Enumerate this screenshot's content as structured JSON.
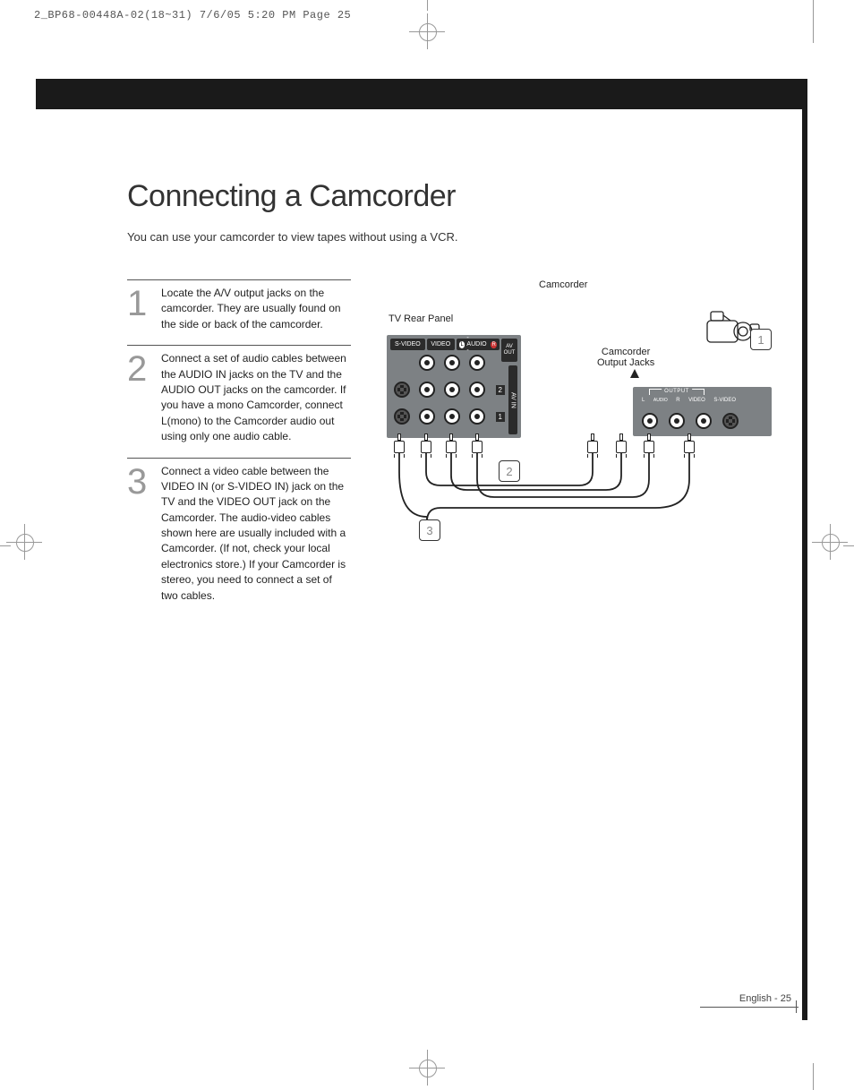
{
  "slug": "2_BP68-00448A-02(18~31)  7/6/05  5:20 PM  Page 25",
  "title": "Connecting a Camcorder",
  "intro": "You can use your camcorder to view tapes without using a VCR.",
  "steps": [
    {
      "num": "1",
      "text": "Locate the A/V output jacks on the camcorder. They are usually found on the side or back of the camcorder."
    },
    {
      "num": "2",
      "text": "Connect a set of audio cables between the AUDIO IN jacks on the TV and the AUDIO OUT jacks on the camcorder. If you have a mono Camcorder, connect L(mono) to the Camcorder audio out using only one audio cable."
    },
    {
      "num": "3",
      "text": "Connect a video cable between the VIDEO IN (or S-VIDEO IN) jack on the TV and the VIDEO OUT jack on the Camcorder. The audio-video cables shown here are usually included with a Camcorder. (If not, check your local electronics store.) If your Camcorder is stereo, you need to connect a set of two cables."
    }
  ],
  "diagram": {
    "camcorder_label": "Camcorder",
    "tv_panel_label": "TV Rear Panel",
    "output_jacks_label": "Camcorder\nOutput Jacks",
    "panel_headers": {
      "svideo": "S-VIDEO",
      "video": "VIDEO",
      "audio_l": "L",
      "audio_sep": "- AUDIO -",
      "audio_r": "R"
    },
    "av_out": "AV\nOUT",
    "av_in": "AV IN",
    "row_nums": [
      "2",
      "1"
    ],
    "output_panel": {
      "output": "OUTPUT",
      "audio": "AUDIO",
      "l": "L",
      "r": "R",
      "video": "VIDEO",
      "svideo": "S-VIDEO"
    },
    "callouts": [
      "1",
      "2",
      "3"
    ]
  },
  "footer": "English - 25"
}
